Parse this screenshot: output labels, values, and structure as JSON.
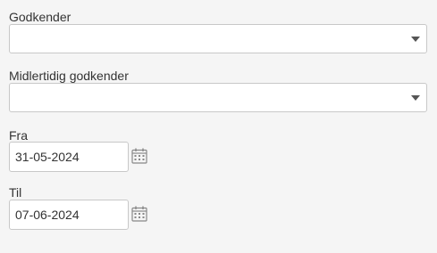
{
  "form": {
    "approver": {
      "label": "Godkender",
      "value": ""
    },
    "temp_approver": {
      "label": "Midlertidig godkender",
      "value": ""
    },
    "from": {
      "label": "Fra",
      "value": "31-05-2024"
    },
    "to": {
      "label": "Til",
      "value": "07-06-2024"
    }
  },
  "icons": {
    "dropdown": "chevron-down-icon",
    "calendar": "calendar-icon"
  },
  "colors": {
    "background": "#f5f5f5",
    "border": "#c8c8c8",
    "text": "#333333",
    "icon": "#888888"
  }
}
